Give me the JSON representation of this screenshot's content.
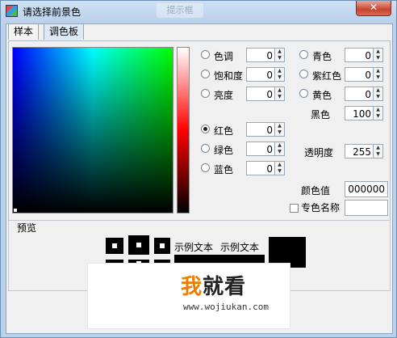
{
  "window": {
    "title": "请选择前景色",
    "background_tab_title": "提示框",
    "close_label": "✕"
  },
  "tabs": [
    {
      "label": "样本",
      "active": false
    },
    {
      "label": "调色板",
      "active": true
    }
  ],
  "hsb": [
    {
      "label": "色调",
      "value": "0",
      "checked": false
    },
    {
      "label": "饱和度",
      "value": "0",
      "checked": false
    },
    {
      "label": "亮度",
      "value": "0",
      "checked": false
    }
  ],
  "rgb": [
    {
      "label": "红色",
      "value": "0",
      "checked": true
    },
    {
      "label": "绿色",
      "value": "0",
      "checked": false
    },
    {
      "label": "蓝色",
      "value": "0",
      "checked": false
    }
  ],
  "cmyk": [
    {
      "label": "青色",
      "value": "0"
    },
    {
      "label": "紫红色",
      "value": "0"
    },
    {
      "label": "黄色",
      "value": "0"
    },
    {
      "label": "黑色",
      "value": "100"
    }
  ],
  "transparency": {
    "label": "透明度",
    "value": "255"
  },
  "color_value": {
    "label": "颜色值",
    "value": "000000"
  },
  "spot_color": {
    "label": "专色名称",
    "checked": false,
    "value": ""
  },
  "preview": {
    "title": "预览",
    "sample_text_1": "示例文本",
    "sample_text_2": "示例文本"
  },
  "watermark": {
    "logo_char_1": "我",
    "logo_rest": "就看",
    "url": "www.wojiukan.com"
  },
  "colors": {
    "selected": "#000000",
    "title_bar": "#cfe0f3",
    "close_button": "#c9452f"
  }
}
